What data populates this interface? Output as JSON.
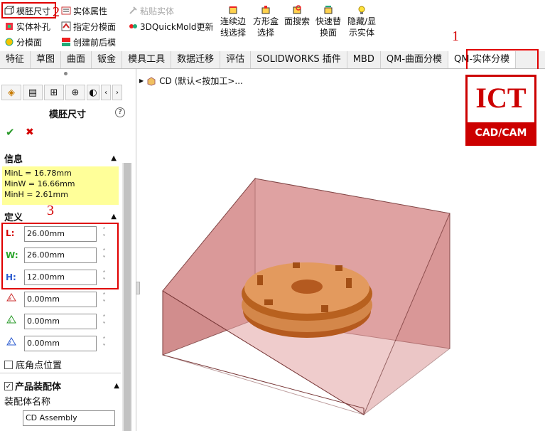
{
  "toolbar": {
    "col1": [
      "模胚尺寸",
      "实体补孔",
      "分模面"
    ],
    "col2": [
      "实体属性",
      "指定分模面",
      "创建前后模"
    ],
    "col3": [
      "粘贴实体",
      "3DQuickMold更新"
    ],
    "big_buttons": [
      {
        "line1": "连续边",
        "line2": "线选择",
        "icon": "edge-select-icon"
      },
      {
        "line1": "方形盒",
        "line2": "选择",
        "icon": "box-select-icon"
      },
      {
        "line1": "面搜索",
        "line2": "",
        "icon": "face-search-icon"
      },
      {
        "line1": "快速替",
        "line2": "换面",
        "icon": "replace-face-icon"
      },
      {
        "line1": "隐藏/显",
        "line2": "示实体",
        "icon": "lightbulb-icon"
      }
    ]
  },
  "tabs": [
    "特征",
    "草图",
    "曲面",
    "钣金",
    "模具工具",
    "数据迁移",
    "评估",
    "SOLIDWORKS 插件",
    "MBD",
    "QM-曲面分模",
    "QM-实体分模"
  ],
  "annotations": {
    "n1": "1",
    "n2": "2",
    "n3": "3"
  },
  "panel": {
    "title": "模胚尺寸",
    "ok": "✔",
    "cancel": "✖",
    "info_header": "信息",
    "info": [
      "MinL = 16.78mm",
      "MinW = 16.66mm",
      "MinH = 2.61mm"
    ],
    "def_header": "定义",
    "fields": [
      {
        "label": "L:",
        "value": "26.00mm",
        "color": "#d40000"
      },
      {
        "label": "W:",
        "value": "26.00mm",
        "color": "#2aa52a"
      },
      {
        "label": "H:",
        "value": "12.00mm",
        "color": "#2b5bd0"
      }
    ],
    "offsets": [
      "0.00mm",
      "0.00mm",
      "0.00mm"
    ],
    "corner_label": "底角点位置",
    "assembly_label": "产品装配体",
    "assembly_name_label": "装配体名称",
    "assembly_name": "CD Assembly"
  },
  "tree": {
    "label": "CD  (默认<按加工>..."
  },
  "logo": {
    "top": "ICT",
    "bottom": "CAD/CAM"
  }
}
